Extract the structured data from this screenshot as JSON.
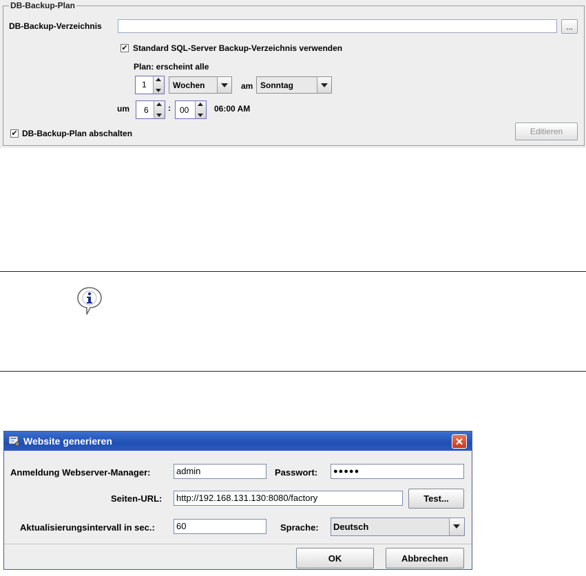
{
  "backup_plan": {
    "group_title": "DB-Backup-Plan",
    "dir_label": "DB-Backup-Verzeichnis",
    "dir_value": "",
    "browse_label": "...",
    "use_default_label": "Standard SQL-Server Backup-Verzeichnis verwenden",
    "use_default_checked": true,
    "plan_label": "Plan: erscheint alle",
    "interval_value": "1",
    "interval_unit": "Wochen",
    "am_label": "am",
    "weekday": "Sonntag",
    "um_label": "um",
    "hour": "6",
    "minute_sep": ":",
    "minute": "00",
    "time_text": "06:00 AM",
    "disable_label": "DB-Backup-Plan abschalten",
    "disable_checked": true,
    "edit_label": "Editieren"
  },
  "info": {
    "icon": "info-icon"
  },
  "dialog": {
    "title": "Website generieren",
    "close_glyph": "✕",
    "login_label": "Anmeldung Webserver-Manager:",
    "login_value": "admin",
    "password_label": "Passwort:",
    "password_value": "●●●●●",
    "url_label": "Seiten-URL:",
    "url_value": "http://192.168.131.130:8080/factory",
    "test_label": "Test...",
    "interval_label": "Aktualisierungsintervall in sec.:",
    "interval_value": "60",
    "language_label": "Sprache:",
    "language_value": "Deutsch",
    "ok_label": "OK",
    "cancel_label": "Abbrechen"
  }
}
